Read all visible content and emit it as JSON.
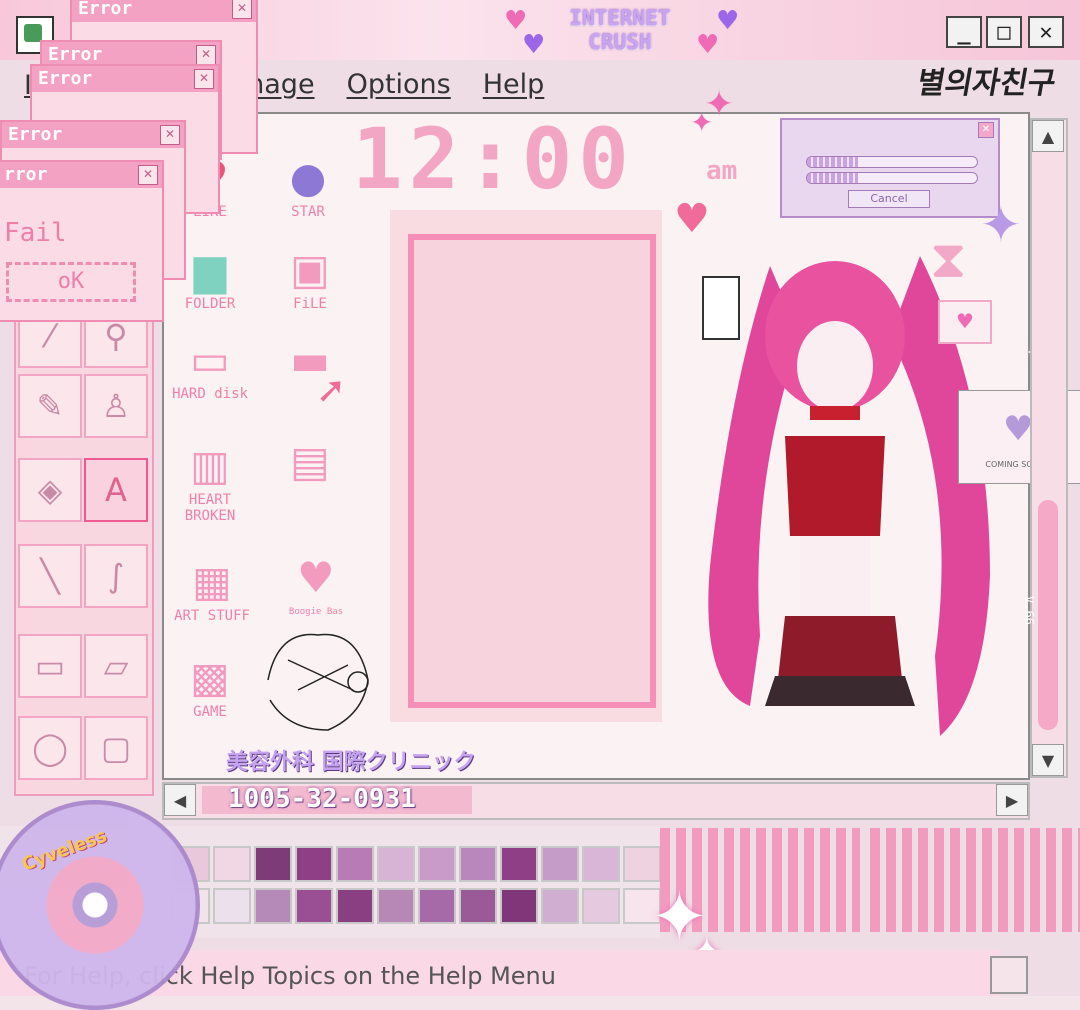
{
  "brand": {
    "line1": "INTERNET",
    "line2": "CRUSH"
  },
  "korean_logo": "별의자친구",
  "window_controls": {
    "minimize": "_",
    "maximize": "□",
    "close": "✕"
  },
  "menu": {
    "items": [
      "Image",
      "Options",
      "Help"
    ],
    "partial_first": "I"
  },
  "clock": {
    "time": "12:00",
    "ampm": "am"
  },
  "desktop_icons": [
    {
      "label": "LIKE",
      "icon": "heart-icon"
    },
    {
      "label": "STAR",
      "icon": "planet-icon"
    },
    {
      "label": "FOLDER",
      "icon": "folder-icon"
    },
    {
      "label": "FiLE",
      "icon": "floppy-icon"
    },
    {
      "label": "HARD disk",
      "icon": "computer-icon"
    },
    {
      "label": "",
      "icon": "camera-icon"
    },
    {
      "label": "HEART BROKEN",
      "icon": "trash-icon"
    },
    {
      "label": "",
      "icon": "retro-pc-icon"
    },
    {
      "label": "ART STUFF",
      "icon": "tv-icon"
    },
    {
      "label": "Boogie Bas",
      "icon": "basket-icon"
    },
    {
      "label": "GAME",
      "icon": "gameboy-icon"
    }
  ],
  "error_dialogs": [
    {
      "title": "Error"
    },
    {
      "title": "Error"
    },
    {
      "title": "Error"
    },
    {
      "title": "Error"
    },
    {
      "title": "rror",
      "message": "Fail",
      "button": "oK"
    }
  ],
  "progress_dialog": {
    "bar1": 0.3,
    "bar2": 0.3,
    "cancel_label": "Cancel"
  },
  "mini_window": {
    "text": "COMING SOON..."
  },
  "scroll": {
    "version": "V.66"
  },
  "clinic": "美容外科 国際クリニック",
  "phone": "1005-32-0931",
  "status_text": "For Help, click Help Topics on the Help Menu",
  "cd_label": "Cyveless",
  "palette": {
    "row1": [
      "#e8c8da",
      "#f1d6e3",
      "#7d3b78",
      "#8f3f86",
      "#b87bb5",
      "#d7b3d6",
      "#c89bc8",
      "#b987bb",
      "#8f3f86",
      "#c59bc8",
      "#d9b6d8",
      "#efd2e0"
    ],
    "row2": [
      "#f2e2ea",
      "#ece0ec",
      "#b58ab8",
      "#9a4f95",
      "#8a3f83",
      "#b787b6",
      "#a76aa8",
      "#9a5a97",
      "#7f3779",
      "#d0aed1",
      "#e4c9df",
      "#f7e4ec"
    ]
  }
}
